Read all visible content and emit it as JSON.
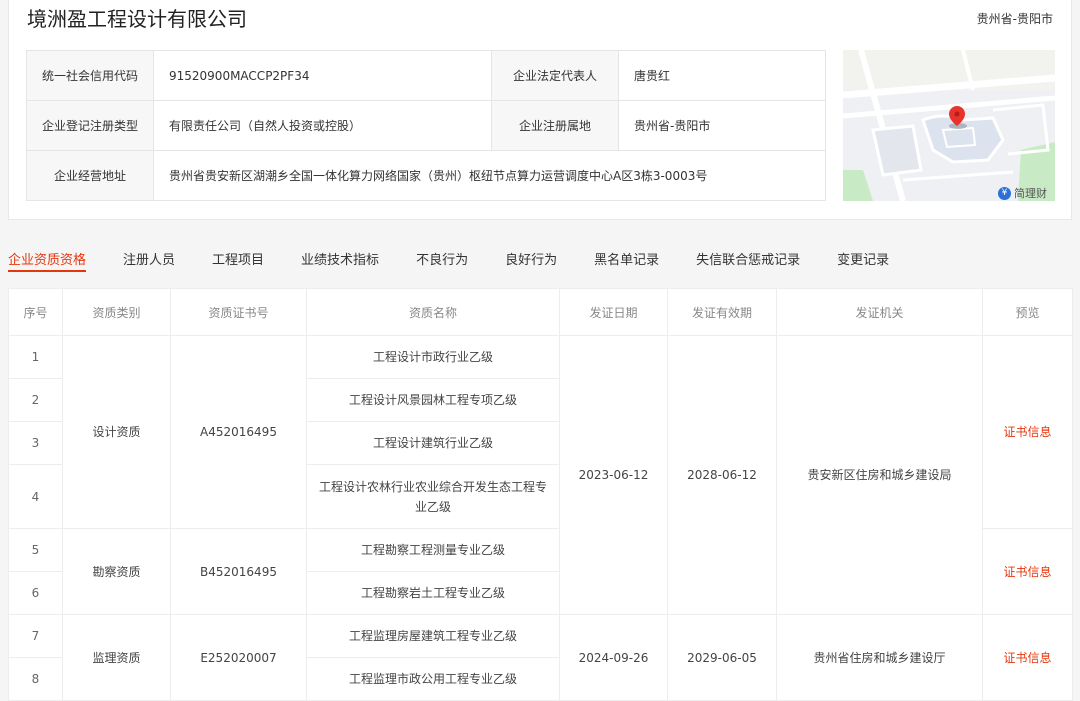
{
  "company": {
    "name": "境洲盈工程设计有限公司",
    "region": "贵州省-贵阳市"
  },
  "info": {
    "credit_code_label": "统一社会信用代码",
    "credit_code": "91520900MACCP2PF34",
    "legal_rep_label": "企业法定代表人",
    "legal_rep": "唐贵红",
    "reg_type_label": "企业登记注册类型",
    "reg_type": "有限责任公司（自然人投资或控股）",
    "reg_place_label": "企业注册属地",
    "reg_place": "贵州省-贵阳市",
    "address_label": "企业经营地址",
    "address": "贵州省贵安新区湖潮乡全国一体化算力网络国家（贵州）枢纽节点算力运营调度中心A区3栋3-0003号"
  },
  "map": {
    "brand": "简理财",
    "brand_icon": "yen-coin-icon",
    "marker_color": "#e8322c"
  },
  "tabs": [
    "企业资质资格",
    "注册人员",
    "工程项目",
    "业绩技术指标",
    "不良行为",
    "良好行为",
    "黑名单记录",
    "失信联合惩戒记录",
    "变更记录"
  ],
  "accent_color": "#e5370e",
  "table": {
    "headers": [
      "序号",
      "资质类别",
      "资质证书号",
      "资质名称",
      "发证日期",
      "发证有效期",
      "发证机关",
      "预览"
    ],
    "rows": [
      {
        "seq": "1",
        "name": "工程设计市政行业乙级"
      },
      {
        "seq": "2",
        "name": "工程设计风景园林工程专项乙级"
      },
      {
        "seq": "3",
        "name": "工程设计建筑行业乙级"
      },
      {
        "seq": "4",
        "name": "工程设计农林行业农业综合开发生态工程专业乙级"
      },
      {
        "seq": "5",
        "name": "工程勘察工程测量专业乙级"
      },
      {
        "seq": "6",
        "name": "工程勘察岩土工程专业乙级"
      },
      {
        "seq": "7",
        "name": "工程监理房屋建筑工程专业乙级"
      },
      {
        "seq": "8",
        "name": "工程监理市政公用工程专业乙级"
      }
    ],
    "groups": [
      {
        "category": "设计资质",
        "cert": "A452016495",
        "preview": "证书信息"
      },
      {
        "category": "勘察资质",
        "cert": "B452016495",
        "preview": "证书信息"
      },
      {
        "category": "监理资质",
        "cert": "E252020007",
        "preview": "证书信息"
      }
    ],
    "issue_blocks": [
      {
        "date": "2023-06-12",
        "valid": "2028-06-12",
        "authority": "贵安新区住房和城乡建设局"
      },
      {
        "date": "2024-09-26",
        "valid": "2029-06-05",
        "authority": "贵州省住房和城乡建设厅"
      }
    ]
  }
}
